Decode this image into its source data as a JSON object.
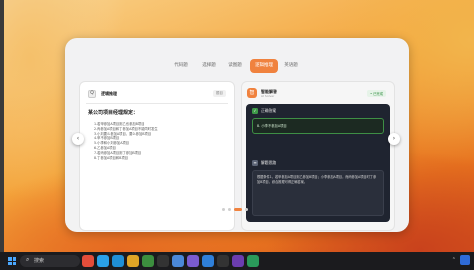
{
  "taskbar": {
    "search_placeholder": "搜索",
    "apps": [
      {
        "icon": "balloon-icon",
        "color": "#e44d3a"
      },
      {
        "icon": "gift-icon",
        "color": "#2aa1e8"
      },
      {
        "icon": "edge-icon",
        "color": "#1f8fd6"
      },
      {
        "icon": "explorer-icon",
        "color": "#e0a526"
      },
      {
        "icon": "chrome-icon",
        "color": "#3c8e3e"
      },
      {
        "icon": "terminal-icon",
        "color": "#333333"
      },
      {
        "icon": "photos-icon",
        "color": "#4b88d9"
      },
      {
        "icon": "app-icon",
        "color": "#7a5bd0"
      },
      {
        "icon": "mail-icon",
        "color": "#2f7fd9"
      },
      {
        "icon": "store-icon",
        "color": "#333333"
      },
      {
        "icon": "game-icon",
        "color": "#6b3db0"
      },
      {
        "icon": "chat-icon",
        "color": "#2a9a5a"
      }
    ],
    "accent": "#4aa8ff"
  },
  "carousel": {
    "tabs": [
      "代码题",
      "选择题",
      "读图题",
      "逻辑推理",
      "英语题"
    ],
    "active_tab": 3,
    "accent": "#f0823e",
    "dots": 4,
    "active_dot": 2
  },
  "question_panel": {
    "icon_label": "Q",
    "title": "逻辑推理",
    "tag": "题目",
    "question_title": "某公司项目经理规定：",
    "lines": [
      "1.若甲参加A项目则乙也参加B项目",
      "2.丙参加A项目和丁参加A项目不能同时发生",
      "3.小刘要么参加A项目，要么参加B项目",
      "4.甲不参加B项目",
      "5.小李和小刘参加A项目",
      "6.乙参加A项目",
      "7.若丙参加A项目则丁参加B项目",
      "8.丁参加A项目和B项目"
    ]
  },
  "answer_panel": {
    "icon_label": "智",
    "name": "智能解答",
    "subtitle": "AI Solver",
    "tag": "• 已完成",
    "answer_section": "正确答案",
    "answer_text": "B. 小李不参加A项目",
    "analysis_section": "解题思路",
    "analysis_text": "根据条件1，若甲参加A项目则乙参加B项目；小李参加A项目，而丙参加A项目时丁参加B项目，综合推理可得正确答案。"
  }
}
